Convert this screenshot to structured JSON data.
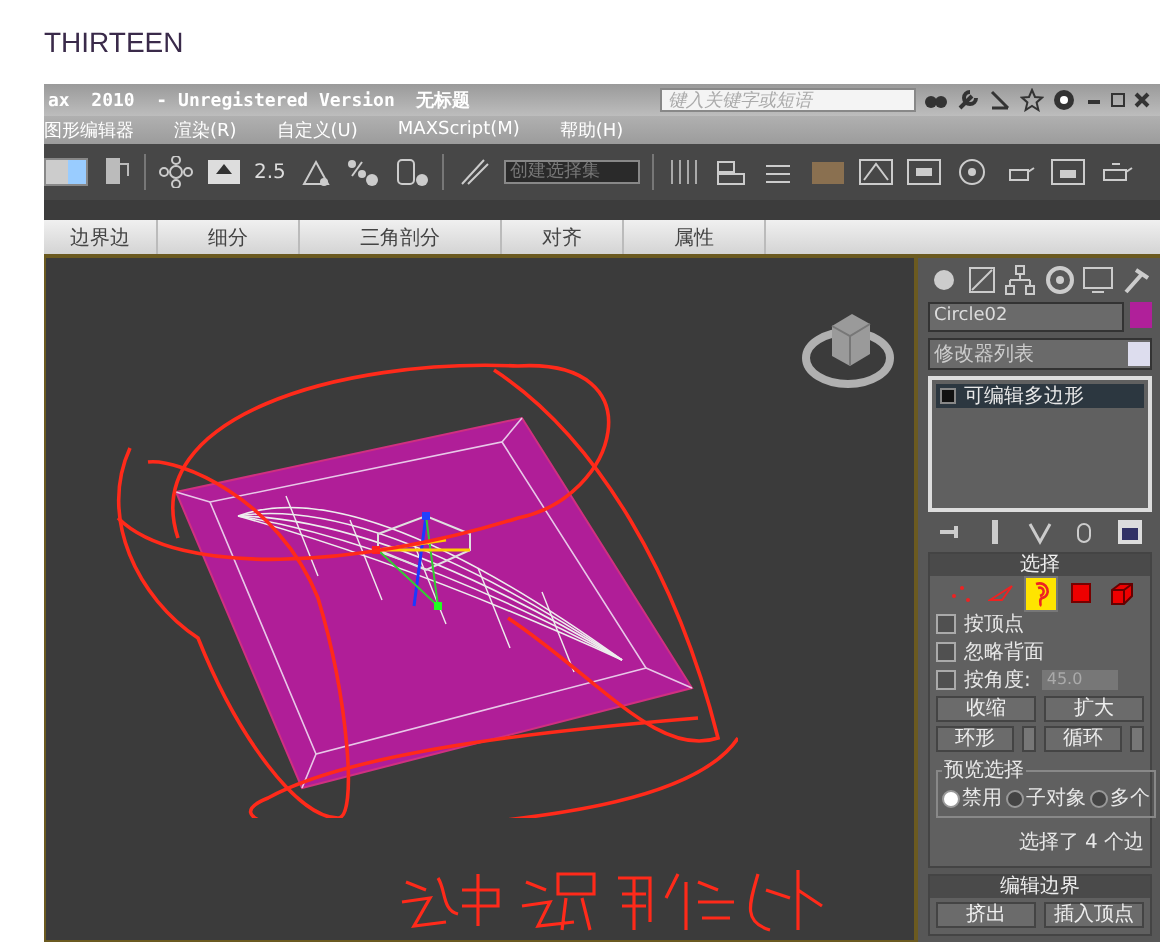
{
  "page": {
    "heading": "THIRTEEN"
  },
  "window": {
    "title": "ax  2010  - Unregistered Version  无标题",
    "search_placeholder": "键入关键字或短语"
  },
  "menu": [
    "图形编辑器",
    "渲染(R)",
    "自定义(U)",
    "MAXScript(M)",
    "帮助(H)"
  ],
  "toolbar": {
    "snap_value": "2.5",
    "selection_set": "创建选择集"
  },
  "ribbon_tabs": [
    {
      "label": "边界边",
      "selected": false
    },
    {
      "label": "细分",
      "selected": false
    },
    {
      "label": "三角剖分",
      "selected": false
    },
    {
      "label": "对齐",
      "selected": false
    },
    {
      "label": "属性",
      "selected": false
    }
  ],
  "command_panel": {
    "object_name": "Circle02",
    "modifier_list": "修改器列表",
    "stack": [
      {
        "label": "可编辑多边形",
        "selected": true
      }
    ],
    "selection_rollout": {
      "title": "选择",
      "subobject_levels": [
        {
          "kind": "vertex",
          "selected": false
        },
        {
          "kind": "edge",
          "selected": false
        },
        {
          "kind": "border",
          "selected": true
        },
        {
          "kind": "polygon",
          "selected": false
        },
        {
          "kind": "element",
          "selected": false
        }
      ],
      "checkboxes": [
        {
          "label": "按顶点",
          "checked": false
        },
        {
          "label": "忽略背面",
          "checked": false
        },
        {
          "label": "按角度:",
          "checked": false,
          "value": "45.0"
        }
      ],
      "buttons": [
        "收缩",
        "扩大"
      ],
      "spinner_buttons": [
        "环形",
        "循环"
      ],
      "preview": {
        "title": "预览选择",
        "options": [
          {
            "label": "禁用",
            "selected": true
          },
          {
            "label": "子对象",
            "selected": false
          },
          {
            "label": "多个",
            "selected": false
          }
        ]
      },
      "status": "选择了 4 个边"
    },
    "edit_rollout": {
      "title": "编辑边界",
      "buttons": [
        "挤出",
        "插入顶点"
      ]
    }
  }
}
